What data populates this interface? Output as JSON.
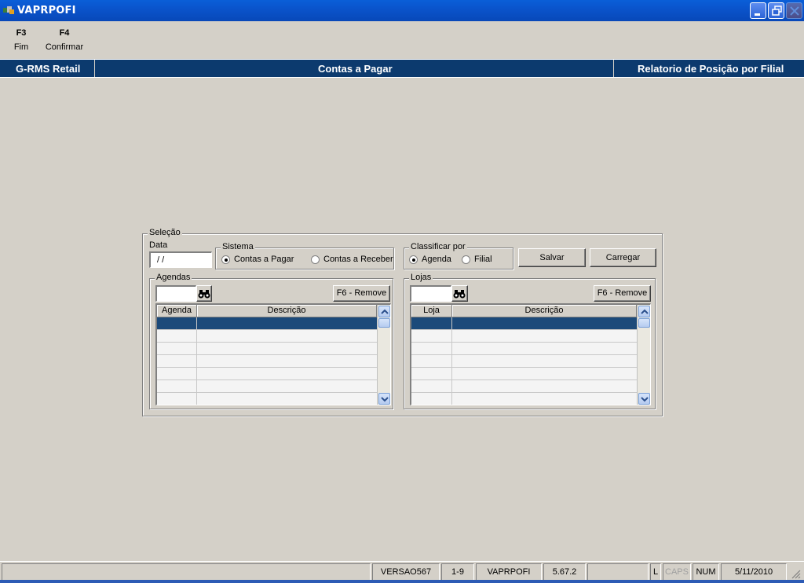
{
  "window": {
    "title": "VAPRPOFI"
  },
  "toolbar": {
    "keys": [
      {
        "key": "F3",
        "label": "Fim"
      },
      {
        "key": "F4",
        "label": "Confirmar"
      }
    ]
  },
  "header": {
    "app": "G-RMS Retail",
    "module": "Contas a Pagar",
    "report": "Relatorio de Posição por Filial"
  },
  "form": {
    "selection_title": "Seleção",
    "date_label": "Data",
    "date_value": " / /",
    "sistema": {
      "title": "Sistema",
      "options": [
        "Contas a Pagar",
        "Contas a Receber"
      ],
      "selected": "Contas a Pagar"
    },
    "classificar": {
      "title": "Classificar por",
      "options": [
        "Agenda",
        "Filial"
      ],
      "selected": "Agenda"
    },
    "save_label": "Salvar",
    "load_label": "Carregar",
    "agendas": {
      "title": "Agendas",
      "remove_label": "F6 - Remove",
      "columns": [
        "Agenda",
        "Descrição"
      ]
    },
    "lojas": {
      "title": "Lojas",
      "remove_label": "F6 - Remove",
      "columns": [
        "Loja",
        "Descrição"
      ]
    }
  },
  "statusbar": {
    "panels": [
      "",
      "VERSAO567",
      "1-9",
      "VAPRPOFI",
      "5.67.2",
      "",
      "L",
      "CAPS",
      "NUM",
      "5/11/2010"
    ]
  },
  "colors": {
    "titlebar": "#0a54cc",
    "header": "#0c3a6e",
    "selected_row": "#1c4a7a",
    "face": "#d4d0c8"
  }
}
